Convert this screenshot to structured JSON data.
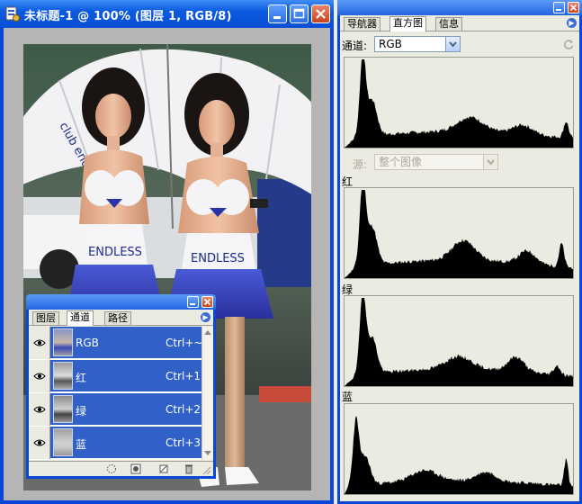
{
  "document": {
    "title": "未标题-1 @ 100% (图层 1, RGB/8)",
    "photo_description": "两位持伞的赛车女郎照片"
  },
  "channels_panel": {
    "tabs": [
      "图层",
      "通道",
      "路径"
    ],
    "active_tab": "通道",
    "channels": [
      {
        "name": "RGB",
        "shortcut": "Ctrl+~"
      },
      {
        "name": "红",
        "shortcut": "Ctrl+1"
      },
      {
        "name": "绿",
        "shortcut": "Ctrl+2"
      },
      {
        "name": "蓝",
        "shortcut": "Ctrl+3"
      }
    ]
  },
  "histogram_panel": {
    "tabs": [
      "导航器",
      "直方图",
      "信息"
    ],
    "active_tab": "直方图",
    "channel_label": "通道:",
    "channel_value": "RGB",
    "source_label": "源:",
    "source_value": "整个图像",
    "red_label": "红",
    "green_label": "绿",
    "blue_label": "蓝"
  },
  "colors": {
    "xp_blue": "#0a47d8",
    "selection_blue": "#3161c8",
    "panel_bg": "#ecebe2",
    "histogram_fill": "#000000"
  }
}
